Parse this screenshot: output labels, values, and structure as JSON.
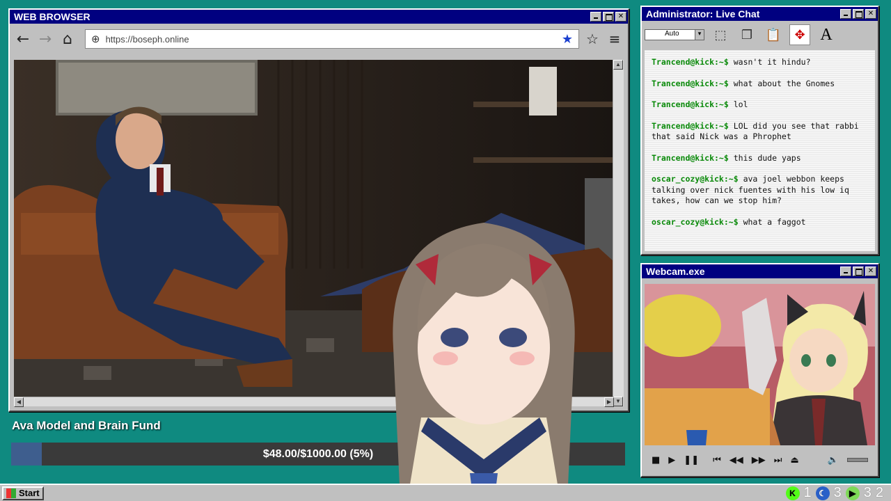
{
  "browser": {
    "title": "WEB BROWSER",
    "url": "https://boseph.online",
    "nav": {
      "back": "back-arrow-icon",
      "forward": "forward-arrow-icon",
      "home": "home-icon"
    }
  },
  "chat": {
    "title": "Administrator: Live Chat",
    "font_select": "Auto",
    "messages": [
      {
        "user": "Trancend@kick:~$",
        "text": "wasn't it hindu?"
      },
      {
        "user": "Trancend@kick:~$",
        "text": "what about the Gnomes"
      },
      {
        "user": "Trancend@kick:~$",
        "text": "lol"
      },
      {
        "user": "Trancend@kick:~$",
        "text": "LOL did you see that rabbi that said Nick was a Phrophet"
      },
      {
        "user": "Trancend@kick:~$",
        "text": "this dude yaps"
      },
      {
        "user": "oscar_cozy@kick:~$",
        "text": "ava joel webbon keeps talking over nick fuentes with his low iq takes, how can we stop him?"
      },
      {
        "user": "oscar_cozy@kick:~$",
        "text": "what a faggot"
      }
    ]
  },
  "webcam": {
    "title": "Webcam.exe"
  },
  "fund": {
    "title": "Ava Model and Brain Fund",
    "progress_text": "$48.00/$1000.00 (5%)",
    "progress_fraction": 0.05
  },
  "taskbar": {
    "start_label": "Start",
    "tray": [
      {
        "icon": "kick-icon",
        "count": "1"
      },
      {
        "icon": "night-icon",
        "count": "3"
      },
      {
        "icon": "play-icon",
        "count": "3"
      },
      {
        "count": "2"
      }
    ]
  },
  "colors": {
    "desktop": "#0f8a80",
    "titlebar": "#000080",
    "chat_user": "#0a8a0a",
    "progress_fill": "#3e5e8e"
  }
}
